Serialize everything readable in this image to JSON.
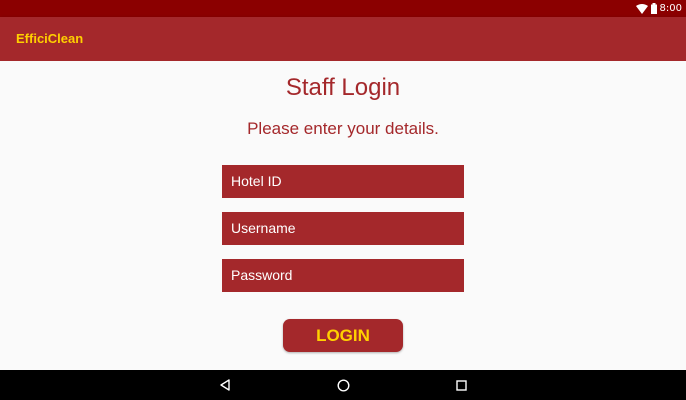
{
  "status_bar": {
    "time": "8:00",
    "icons": [
      "wifi-icon",
      "battery-icon"
    ]
  },
  "app_bar": {
    "title": "EfficiClean"
  },
  "login": {
    "title": "Staff Login",
    "subtitle": "Please enter your details.",
    "hotel_id_hint": "Hotel ID",
    "username_hint": "Username",
    "password_hint": "Password",
    "login_label": "LOGIN"
  },
  "nav_bar": {
    "icons": [
      "back-icon",
      "home-icon",
      "recents-icon"
    ]
  },
  "colors": {
    "status_bar": "#8b0000",
    "primary": "#a4282b",
    "accent": "#ffd000",
    "background": "#fafafa"
  }
}
